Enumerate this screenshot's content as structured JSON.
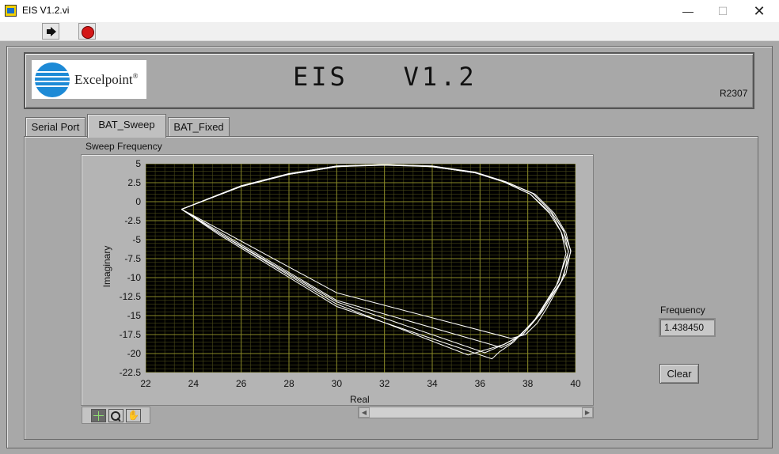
{
  "window": {
    "title": "EIS V1.2.vi",
    "controls": {
      "minimize": "—",
      "maximize": "☐",
      "close": "✕"
    }
  },
  "toolbar": {
    "run_icon": "run-arrow-icon",
    "stop_icon": "abort-stop-icon"
  },
  "header": {
    "logo_text": "Excelpoint",
    "logo_mark": "®",
    "title": "EIS   V1.2",
    "revision": "R2307"
  },
  "tabs": [
    {
      "label": "Serial Port",
      "active": false
    },
    {
      "label": "BAT_Sweep",
      "active": true
    },
    {
      "label": "BAT_Fixed",
      "active": false
    }
  ],
  "graph": {
    "caption": "Sweep Frequency",
    "palette_icons": [
      "cursor-icon",
      "zoom-icon",
      "pan-hand-icon"
    ],
    "colors": {
      "plot_bg": "#000000",
      "grid_major": "#8a8a28",
      "grid_minor": "#4a4a18",
      "trace": "#ffffff"
    }
  },
  "chart_data": {
    "type": "line",
    "title": "",
    "xlabel": "Real",
    "ylabel": "Imaginary",
    "xlim": [
      22,
      40
    ],
    "ylim": [
      -22.5,
      5
    ],
    "xticks": [
      "22",
      "24",
      "26",
      "28",
      "30",
      "32",
      "34",
      "36",
      "38",
      "40"
    ],
    "yticks": [
      "5",
      "2.5",
      "0",
      "-2.5",
      "-5",
      "-7.5",
      "-10",
      "-12.5",
      "-15",
      "-17.5",
      "-20",
      "-22.5"
    ],
    "grid": true,
    "series": [
      {
        "x": [
          23.5,
          24.5,
          26.0,
          28.0,
          30.0,
          32.0,
          34.0,
          35.8,
          37.0,
          38.1,
          38.9,
          39.4,
          39.7,
          39.5,
          38.8,
          38.4,
          37.9,
          37.3,
          30.0,
          25.0,
          23.5
        ],
        "y": [
          -1.0,
          0.2,
          2.0,
          3.6,
          4.6,
          4.9,
          4.6,
          3.8,
          2.6,
          1.0,
          -1.5,
          -4.0,
          -6.5,
          -10.0,
          -14.0,
          -16.0,
          -17.5,
          -18.0,
          -12.0,
          -3.5,
          -1.0
        ]
      },
      {
        "x": [
          23.5,
          26.0,
          28.0,
          30.0,
          32.0,
          34.0,
          35.8,
          37.0,
          38.2,
          39.0,
          39.5,
          39.8,
          39.6,
          38.6,
          37.8,
          37.0,
          35.5,
          30.0,
          25.0,
          23.5
        ],
        "y": [
          -1.0,
          2.1,
          3.7,
          4.7,
          4.9,
          4.7,
          3.9,
          2.7,
          1.1,
          -1.4,
          -3.9,
          -6.4,
          -9.5,
          -14.5,
          -17.5,
          -18.8,
          -20.2,
          -13.5,
          -4.0,
          -1.0
        ]
      },
      {
        "x": [
          23.5,
          26.0,
          28.0,
          30.0,
          32.0,
          34.0,
          35.8,
          37.1,
          38.3,
          39.1,
          39.6,
          39.8,
          39.4,
          38.3,
          37.4,
          36.8,
          36.5,
          30.0,
          25.0,
          23.5
        ],
        "y": [
          -1.0,
          2.0,
          3.6,
          4.6,
          4.8,
          4.6,
          3.8,
          2.6,
          1.0,
          -1.5,
          -4.1,
          -6.6,
          -10.5,
          -15.5,
          -18.5,
          -19.8,
          -20.7,
          -13.8,
          -4.2,
          -1.0
        ]
      },
      {
        "x": [
          23.5,
          26.0,
          28.0,
          30.0,
          32.0,
          34.0,
          35.8,
          37.0,
          38.1,
          39.0,
          39.4,
          39.6,
          39.3,
          38.5,
          37.7,
          37.0,
          36.2,
          30.0,
          25.0,
          23.5
        ],
        "y": [
          -1.0,
          2.0,
          3.6,
          4.6,
          4.9,
          4.6,
          3.8,
          2.6,
          1.0,
          -1.6,
          -4.0,
          -6.8,
          -10.5,
          -14.8,
          -17.6,
          -18.8,
          -19.9,
          -13.2,
          -4.0,
          -1.0
        ]
      },
      {
        "x": [
          23.5,
          26.0,
          28.0,
          30.0,
          32.0,
          34.0,
          35.8,
          37.0,
          38.2,
          39.0,
          39.5,
          39.7,
          39.2,
          38.2,
          37.3,
          36.9,
          30.0,
          25.0,
          23.5
        ],
        "y": [
          -1.0,
          2.1,
          3.7,
          4.7,
          4.9,
          4.7,
          3.8,
          2.7,
          1.1,
          -1.4,
          -3.8,
          -6.6,
          -11.0,
          -16.0,
          -18.6,
          -19.2,
          -13.0,
          -3.8,
          -1.0
        ]
      }
    ]
  },
  "frequency": {
    "label": "Frequency",
    "value": "1.438450"
  },
  "clear_button": {
    "label": "Clear"
  }
}
